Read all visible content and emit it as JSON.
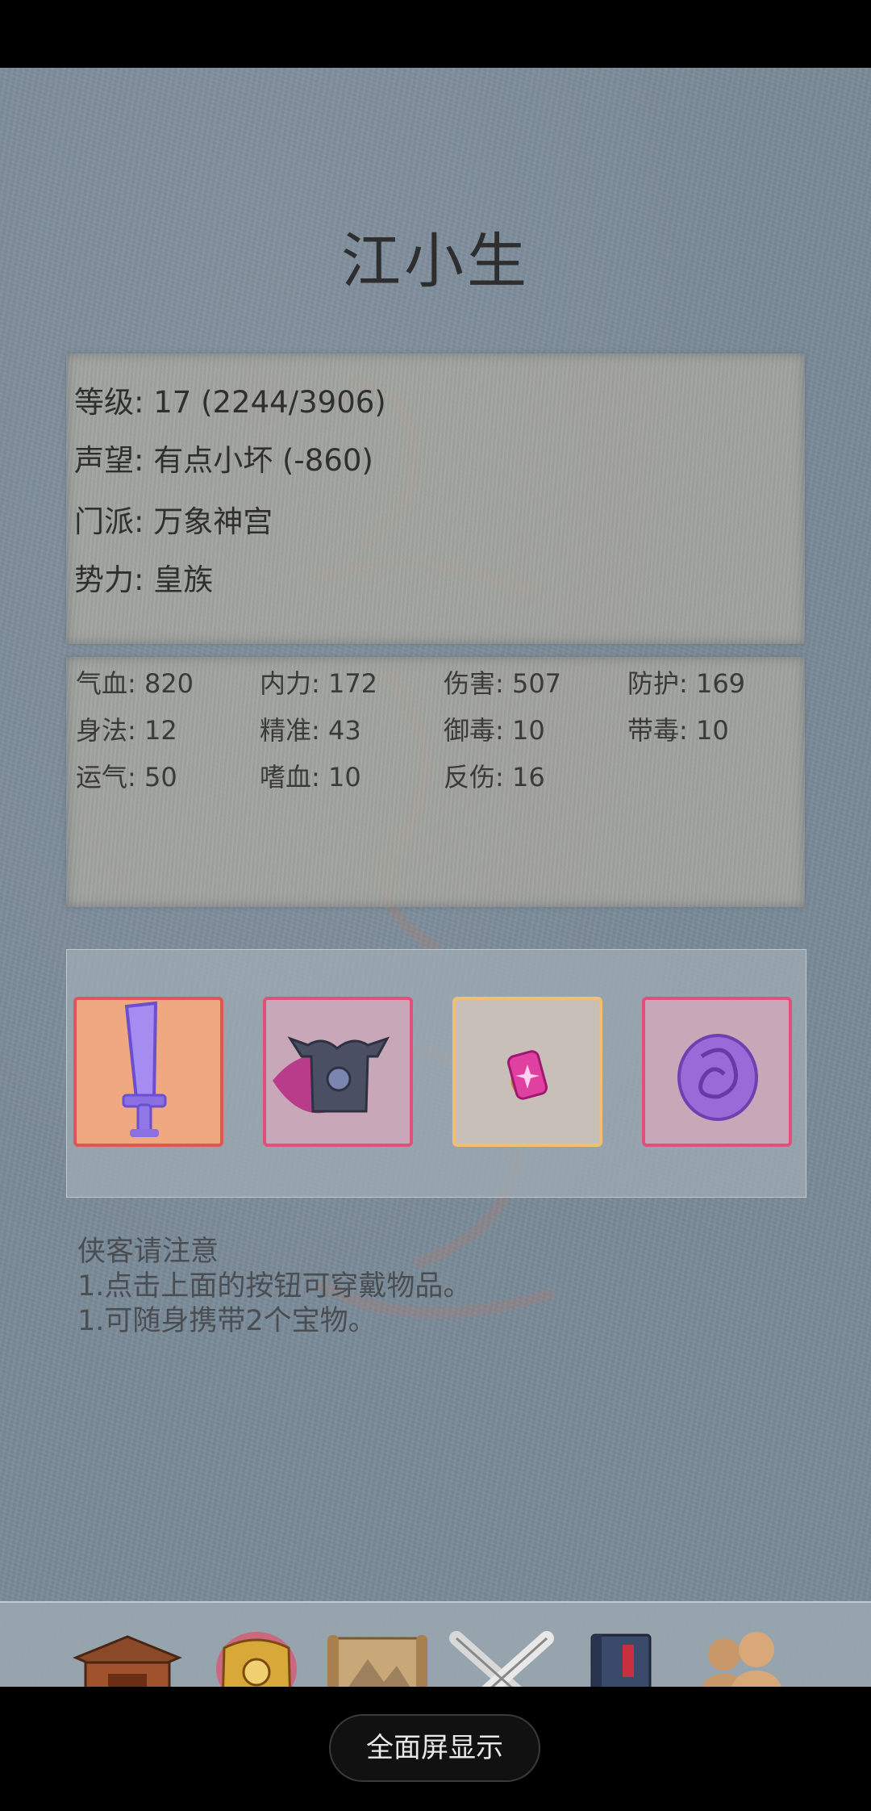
{
  "character": {
    "name": "江小生"
  },
  "info": {
    "level": "等级: 17 (2244/3906)",
    "reputation": "声望: 有点小坏 (-860)",
    "sect": "门派: 万象神宫",
    "faction": "势力:  皇族"
  },
  "stats": [
    "气血: 820",
    "内力: 172",
    "伤害: 507",
    "防护: 169",
    "身法: 12",
    "精准: 43",
    "御毒: 10",
    "带毒: 10",
    "运气: 50",
    "嗜血: 10",
    "反伤: 16"
  ],
  "equipment": [
    {
      "icon": "sword-icon",
      "border": "#e05555",
      "bg": "#f0a880"
    },
    {
      "icon": "armor-icon",
      "border": "#e0507a",
      "bg": "#c8a8b8"
    },
    {
      "icon": "gem-icon",
      "border": "#f0c070",
      "bg": "#c8c0b8"
    },
    {
      "icon": "purple-orb-icon",
      "border": "#e0507a",
      "bg": "#c8a8b8"
    }
  ],
  "notes": {
    "title": "侠客请注意",
    "line1": "1.点击上面的按钮可穿戴物品。",
    "line2": "1.可随身携带2个宝物。"
  },
  "nav": {
    "home": "首页",
    "equip": "装备",
    "jianghu": "江湖",
    "challenge": "闯关",
    "martial": "武功",
    "partner": "伙伴"
  },
  "system": {
    "fullscreen": "全面屏显示"
  },
  "colors": {
    "background": "#7b8b99",
    "nav_label": "#f2c232",
    "equip_selected": "#e05555"
  }
}
